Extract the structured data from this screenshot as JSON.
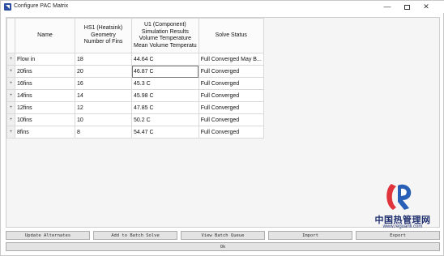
{
  "window": {
    "title": "Configure PAC Matrix"
  },
  "window_controls": {
    "minimize": "—",
    "close": "✕"
  },
  "table": {
    "headers": {
      "name": "Name",
      "hs1": [
        "HS1 (Heatsink)",
        "Geometry",
        "Number of Fins"
      ],
      "u1": [
        "U1 (Component)",
        "Simulation Results",
        "Volume Temperature",
        "Mean Volume Temperatu"
      ],
      "status": "Solve Status"
    },
    "expand_glyph": "+",
    "rows": [
      {
        "name": "Flow in",
        "fins": "18",
        "temp": "44.64 C",
        "status": "Full Converged May B..."
      },
      {
        "name": "20fins",
        "fins": "20",
        "temp": "46.87 C",
        "status": "Full Converged"
      },
      {
        "name": "16fins",
        "fins": "16",
        "temp": "45.3 C",
        "status": "Full Converged"
      },
      {
        "name": "14fins",
        "fins": "14",
        "temp": "45.98 C",
        "status": "Full Converged"
      },
      {
        "name": "12fins",
        "fins": "12",
        "temp": "47.85 C",
        "status": "Full Converged"
      },
      {
        "name": "10fins",
        "fins": "10",
        "temp": "50.2 C",
        "status": "Full Converged"
      },
      {
        "name": "8fins",
        "fins": "8",
        "temp": "54.47 C",
        "status": "Full Converged"
      }
    ]
  },
  "buttons": {
    "update_alternates": "Update Alternates",
    "add_to_batch": "Add to Batch Solve",
    "view_batch_queue": "View Batch Queue",
    "import": "Import",
    "export": "Export",
    "ok": "Ok"
  },
  "watermark": {
    "name": "中国热管理网",
    "url": "www.reguanli.com"
  },
  "colors": {
    "watermark_red": "#e0343c",
    "watermark_blue": "#2a5fb8",
    "watermark_text": "#1f2f6e"
  }
}
